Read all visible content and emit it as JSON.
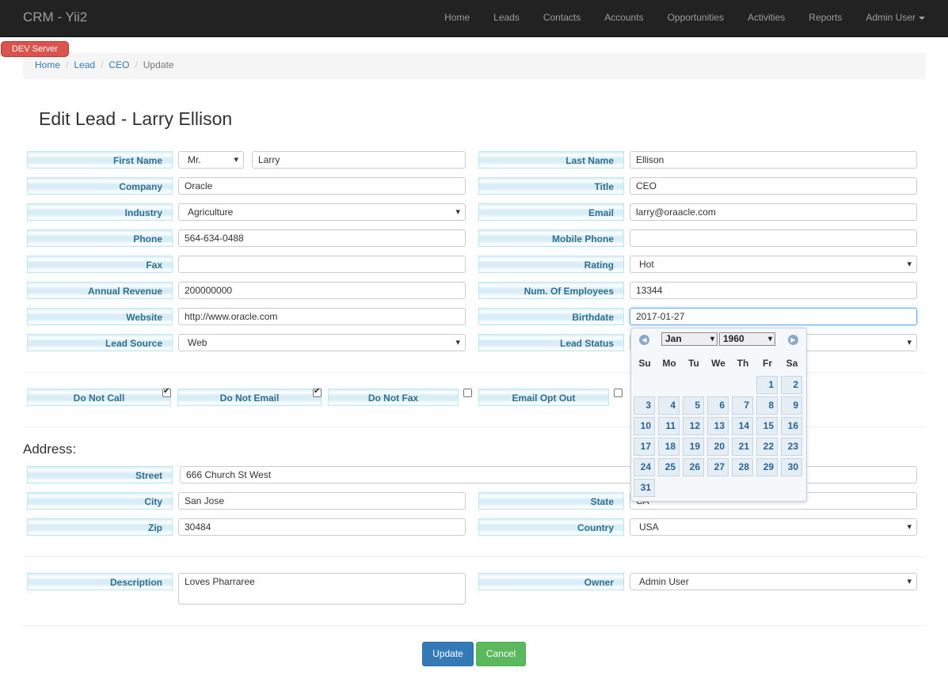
{
  "app": {
    "brand": "CRM - Yii2",
    "dev_badge": "DEV  Server"
  },
  "nav": {
    "items": [
      "Home",
      "Leads",
      "Contacts",
      "Accounts",
      "Opportunities",
      "Activities",
      "Reports",
      "Admin User"
    ]
  },
  "breadcrumb": [
    "Home",
    "Lead",
    "CEO",
    "Update"
  ],
  "page_title": "Edit Lead - Larry Ellison",
  "form": {
    "first_name": {
      "label": "First Name",
      "salutation": "Mr.",
      "value": "Larry"
    },
    "last_name": {
      "label": "Last Name",
      "value": "Ellison"
    },
    "company": {
      "label": "Company",
      "value": "Oracle"
    },
    "title": {
      "label": "Title",
      "value": "CEO"
    },
    "industry": {
      "label": "Industry",
      "value": "Agriculture"
    },
    "email": {
      "label": "Email",
      "value": "larry@oraacle.com"
    },
    "phone": {
      "label": "Phone",
      "value": "564-634-0488"
    },
    "mobile_phone": {
      "label": "Mobile Phone",
      "value": ""
    },
    "fax": {
      "label": "Fax",
      "value": ""
    },
    "rating": {
      "label": "Rating",
      "value": "Hot"
    },
    "annual_revenue": {
      "label": "Annual Revenue",
      "value": "200000000"
    },
    "num_employees": {
      "label": "Num. Of Employees",
      "value": "13344"
    },
    "website": {
      "label": "Website",
      "value": "http://www.oracle.com"
    },
    "birthdate": {
      "label": "Birthdate",
      "value": "2017-01-27"
    },
    "lead_source": {
      "label": "Lead Source",
      "value": "Web"
    },
    "lead_status": {
      "label": "Lead Status",
      "value": ""
    }
  },
  "checkboxes": [
    {
      "label": "Do Not Call",
      "checked": true
    },
    {
      "label": "Do Not Email",
      "checked": true
    },
    {
      "label": "Do Not Fax",
      "checked": false
    },
    {
      "label": "Email Opt Out",
      "checked": false
    }
  ],
  "address": {
    "section_title": "Address:",
    "street": {
      "label": "Street",
      "value": "666 Church St West"
    },
    "city": {
      "label": "City",
      "value": "San Jose"
    },
    "state": {
      "label": "State",
      "value": "CA"
    },
    "zip": {
      "label": "Zip",
      "value": "30484"
    },
    "country": {
      "label": "Country",
      "value": "USA"
    }
  },
  "extra": {
    "description": {
      "label": "Description",
      "value": "Loves Pharraree"
    },
    "owner": {
      "label": "Owner",
      "value": "Admin User"
    }
  },
  "buttons": {
    "update": "Update",
    "cancel": "Cancel"
  },
  "datepicker": {
    "month": "Jan",
    "year": "1960",
    "weekdays": [
      "Su",
      "Mo",
      "Tu",
      "We",
      "Th",
      "Fr",
      "Sa"
    ],
    "first_weekday_index": 5,
    "days_in_month": 31
  }
}
